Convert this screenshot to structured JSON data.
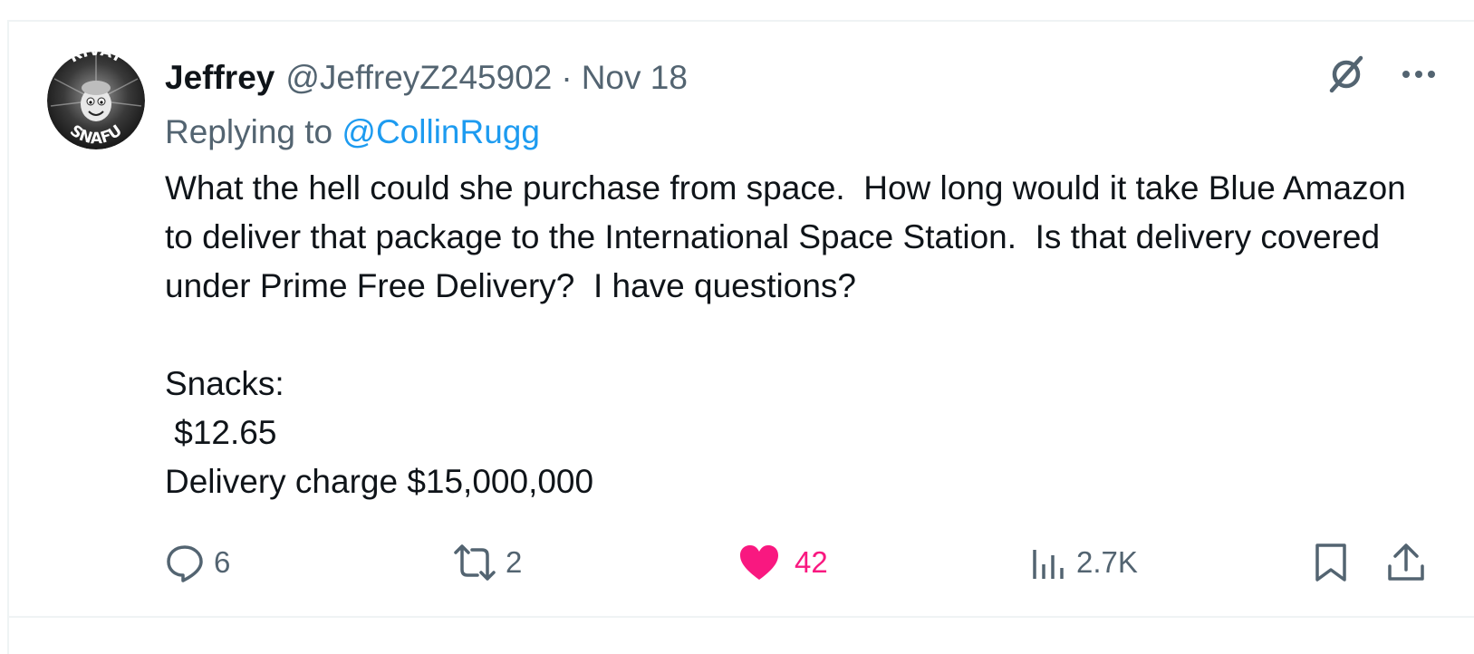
{
  "tweet": {
    "author": {
      "name": "Jeffrey",
      "handle": "@JeffreyZ245902",
      "avatar_text_top": "RIVAT",
      "avatar_text_bottom": "SNAFU"
    },
    "separator": "·",
    "date": "Nov 18",
    "replying_prefix": "Replying to",
    "replying_to": "@CollinRugg",
    "text": "What the hell could she purchase from space.  How long would it take Blue Amazon to deliver that package to the International Space Station.  Is that delivery covered under Prime Free Delivery?  I have questions?\n\nSnacks:\n $12.65\nDelivery charge $15,000,000"
  },
  "icons": {
    "grok": "grok-icon",
    "more": "more-icon",
    "reply": "reply-icon",
    "retweet": "retweet-icon",
    "like": "heart-icon",
    "views": "views-icon",
    "bookmark": "bookmark-icon",
    "share": "share-icon"
  },
  "metrics": {
    "replies": "6",
    "retweets": "2",
    "likes": "42",
    "views": "2.7K",
    "liked": true
  },
  "colors": {
    "text_primary": "#0f1419",
    "text_secondary": "#536471",
    "link": "#1d9bf0",
    "like_active": "#f91880",
    "border": "#eff3f4"
  }
}
